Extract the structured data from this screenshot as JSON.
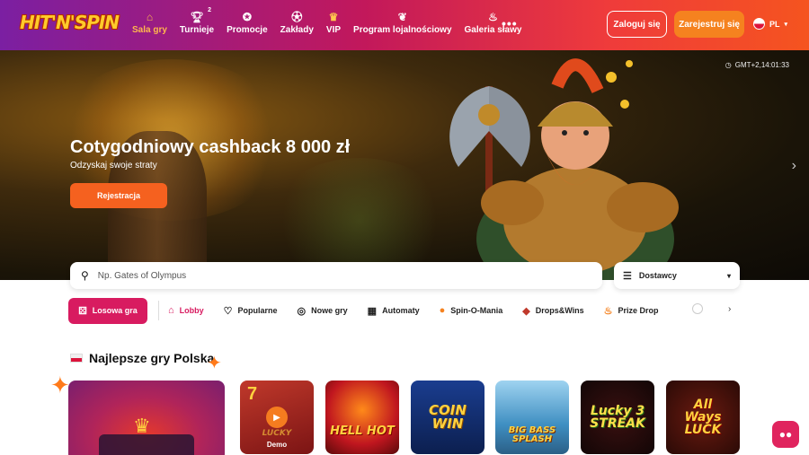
{
  "header": {
    "logo": "HIT'N'SPIN",
    "nav": [
      {
        "label": "Sala gry",
        "icon": "home-icon",
        "active": true
      },
      {
        "label": "Turnieje",
        "icon": "trophy-icon",
        "badge": "2"
      },
      {
        "label": "Promocje",
        "icon": "promo-icon"
      },
      {
        "label": "Zakłady",
        "icon": "ball-icon"
      },
      {
        "label": "VIP",
        "icon": "crown-icon"
      },
      {
        "label": "Program lojalnościowy",
        "icon": "wings-icon"
      },
      {
        "label": "Galeria sławy",
        "icon": "flame-icon"
      }
    ],
    "more": "•••",
    "login_label": "Zaloguj się",
    "register_label": "Zarejestruj się",
    "language": "PL"
  },
  "hero": {
    "time": "GMT+2,14:01:33",
    "title": "Cotygodniowy cashback 8 000 zł",
    "subtitle": "Odzyskaj swoje straty",
    "cta_label": "Rejestracja"
  },
  "search": {
    "placeholder": "Np. Gates of Olympus",
    "providers_label": "Dostawcy"
  },
  "categories": {
    "random_label": "Losowa gra",
    "items": [
      {
        "label": "Lobby",
        "active": true
      },
      {
        "label": "Popularne"
      },
      {
        "label": "Nowe gry"
      },
      {
        "label": "Automaty"
      },
      {
        "label": "Spin-O-Mania"
      },
      {
        "label": "Drops&Wins"
      },
      {
        "label": "Prize Drop"
      }
    ]
  },
  "section": {
    "title": "Najlepsze gry Polska"
  },
  "games": [
    {
      "name": "LUCKY",
      "demo_label": "Demo"
    },
    {
      "name": "HELL HOT"
    },
    {
      "name": "COIN WIN"
    },
    {
      "name": "BIG BASS SPLASH"
    },
    {
      "name": "Lucky 3 STREAK"
    },
    {
      "name": "All Ways LUCK"
    }
  ],
  "colors": {
    "accent": "#d81b60",
    "cta": "#f5611f"
  }
}
